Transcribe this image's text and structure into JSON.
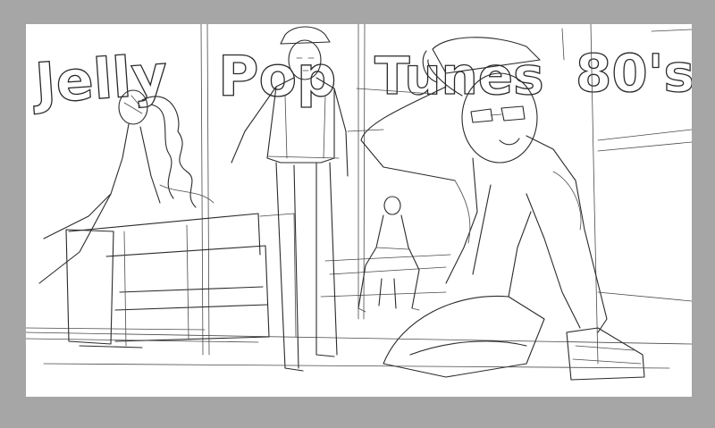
{
  "sign": {
    "line1": "Jelly",
    "line2": "Pop",
    "line3": "Tunes",
    "line4": "80's"
  },
  "colors": {
    "background": "#a6a6a6",
    "paper": "#ffffff",
    "ink": "#2a2a2a"
  }
}
